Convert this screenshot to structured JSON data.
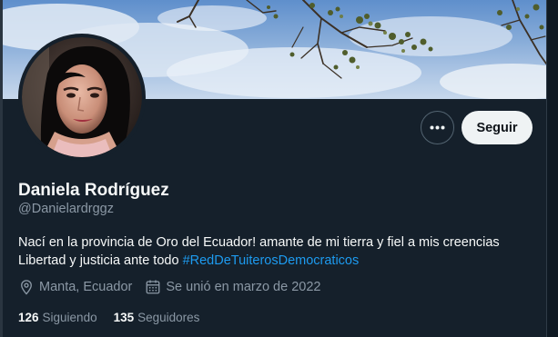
{
  "profile": {
    "display_name": "Daniela Rodríguez",
    "handle": "@Danielardrggz",
    "bio_text": "Nací en la provincia de Oro del Ecuador! amante de mi tierra y fiel a mis creencias Libertad y justicia ante todo ",
    "bio_hashtag": "#RedDeTuiterosDemocraticos",
    "location": "Manta, Ecuador",
    "joined": "Se unió en marzo de 2022"
  },
  "actions": {
    "follow_label": "Seguir",
    "more_icon": "more-horizontal-icon"
  },
  "stats": {
    "following_count": "126",
    "following_label": "Siguiendo",
    "followers_count": "135",
    "followers_label": "Seguidores"
  },
  "colors": {
    "background": "#15202b",
    "link": "#1d9bf0",
    "muted": "#8b98a5",
    "follow_button": "#eff3f4"
  }
}
